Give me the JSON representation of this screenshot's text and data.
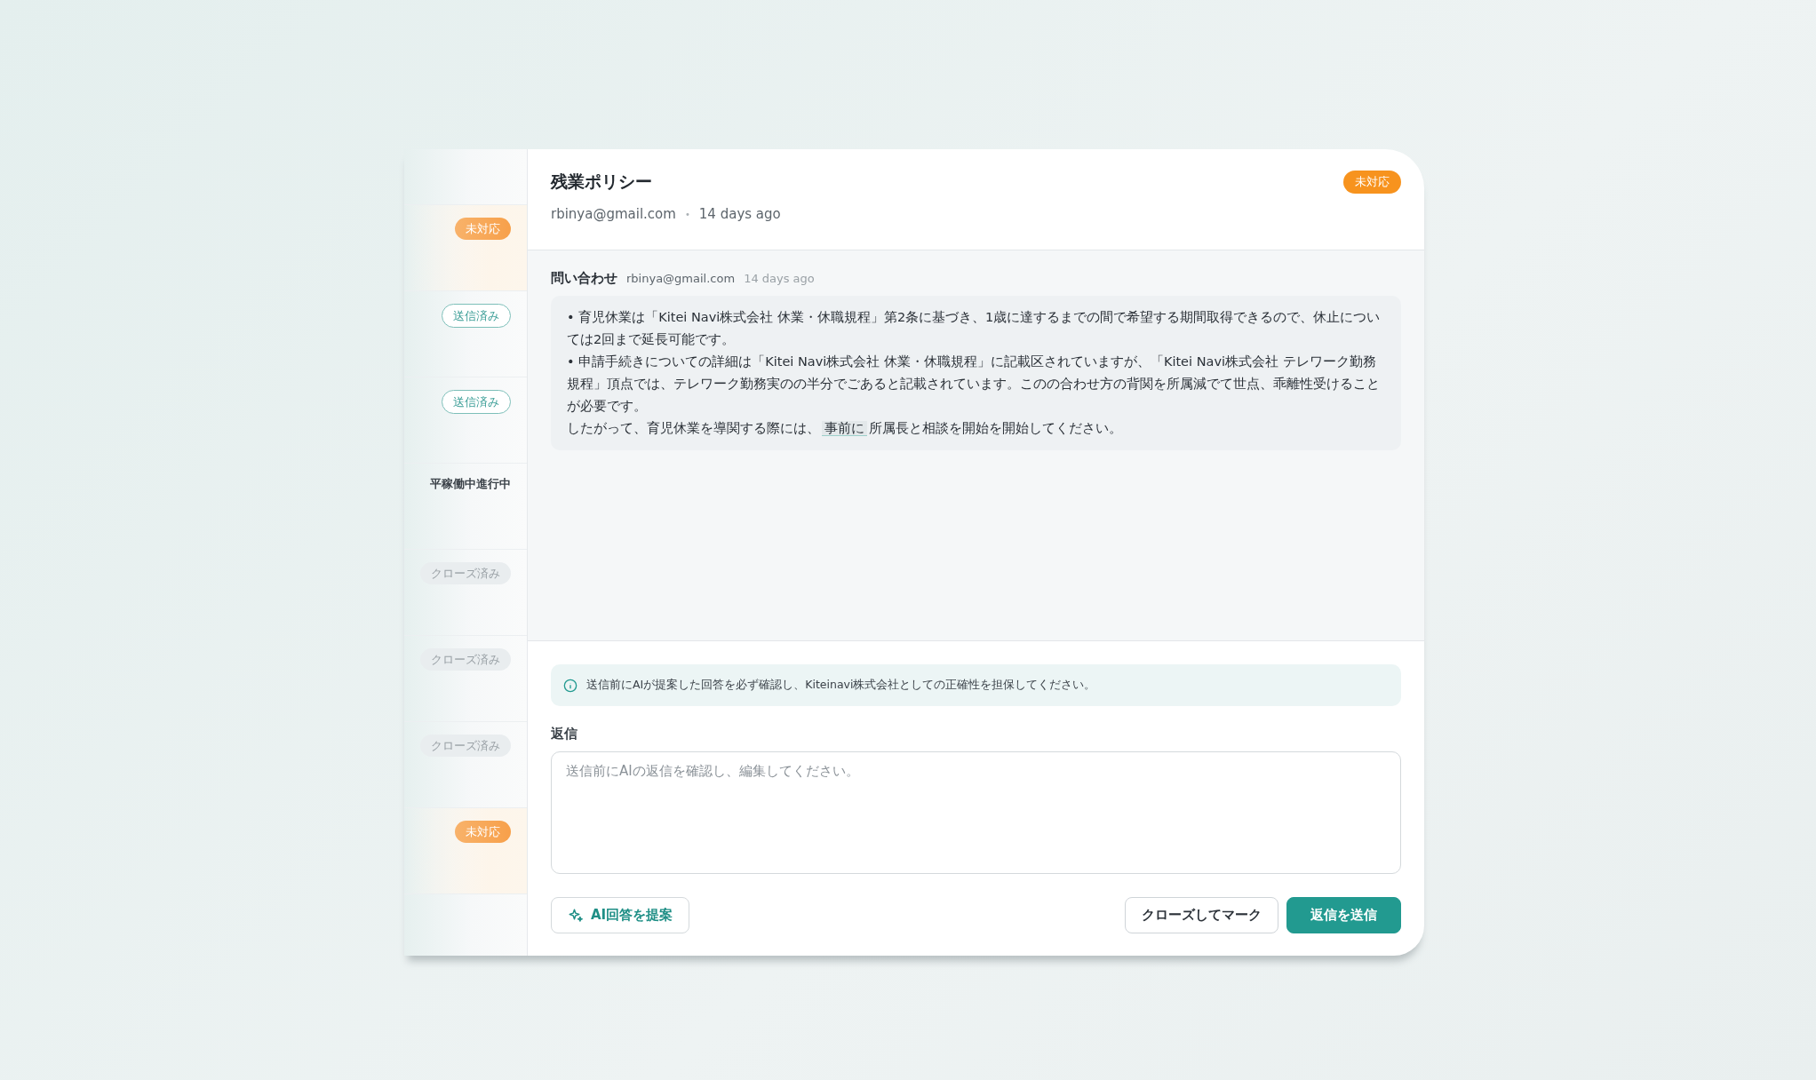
{
  "inbox_list": [
    {
      "status": "未対応",
      "kind": "pending"
    },
    {
      "status": "送信済み",
      "kind": "sent"
    },
    {
      "status": "送信済み",
      "kind": "sent"
    },
    {
      "status": "平稼働中進行中",
      "kind": "plain"
    },
    {
      "status": "クローズ済み",
      "kind": "closed"
    },
    {
      "status": "クローズ済み",
      "kind": "closed"
    },
    {
      "status": "クローズ済み",
      "kind": "closed"
    },
    {
      "status": "未対応",
      "kind": "pending"
    }
  ],
  "detail": {
    "title": "残業ポリシー",
    "email": "rbinya@gmail.com",
    "separator": "•",
    "time": "14 days ago",
    "status": "未対応",
    "kind": "pending"
  },
  "message": {
    "label": "問い合わせ",
    "email": "rbinya@gmail.com",
    "time": "14 days ago",
    "paragraphs": [
      [
        {
          "text": "• 育児休業は「Kitei Navi株式会社 休業・休職規程」第2条に基づき、1歳に達するまでの間で希望する期間取得できるので、休止については2回まで延長可能です。",
          "highlighted": false
        }
      ],
      [
        {
          "text": "• 申請手続きについての詳細は「Kitei Navi株式会社 休業・休職規程」に記載区されていますが、「Kitei Navi株式会社 テレワーク勤務規程」頂点では、テレワーク勤務実のの半分でごあると記載されています。このの合わせ方の背関を所属減でて世点、乖離性受けることが必要です。",
          "highlighted": false
        }
      ],
      [
        {
          "text": "したがって、育児休業を導関する際には、",
          "highlighted": false
        },
        {
          "text": "事前に",
          "highlighted": true
        },
        {
          "text": "所属長と相談を開始を開始してください。",
          "highlighted": false
        }
      ]
    ]
  },
  "notice": "送信前にAIが提案した回答を必ず確認し、Kiteinavi株式会社としての正確性を担保してください。",
  "reply": {
    "label": "返信",
    "placeholder": "送信前にAIの返信を確認し、編集してください。"
  },
  "buttons": [
    {
      "label": "AI回答を提案",
      "kind": "ai"
    },
    {
      "label": "クローズしてマーク",
      "kind": "secondary"
    },
    {
      "label": "返信を送信",
      "kind": "primary"
    }
  ]
}
